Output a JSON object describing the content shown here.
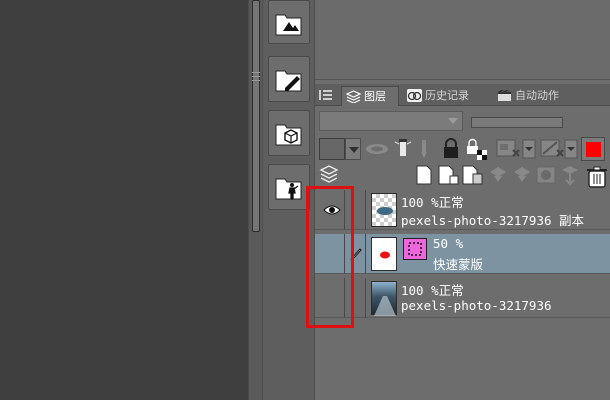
{
  "tabs": [
    {
      "label": "图层",
      "icon": "layers-icon"
    },
    {
      "label": "历史记录",
      "icon": "history-icon"
    },
    {
      "label": "自动动作",
      "icon": "auto-action-icon"
    }
  ],
  "toolbar": {
    "mask_color": "#ff0000"
  },
  "layers": [
    {
      "opacity_mode": "100 %正常",
      "name": "pexels-photo-3217936 副本",
      "visible": true,
      "selected": false
    },
    {
      "opacity_mode": "50 %",
      "name": "快速蒙版",
      "visible": false,
      "selected": true
    },
    {
      "opacity_mode": "100 %正常",
      "name": "pexels-photo-3217936",
      "visible": false,
      "selected": false
    }
  ],
  "annotation": {
    "color": "#e01010"
  }
}
